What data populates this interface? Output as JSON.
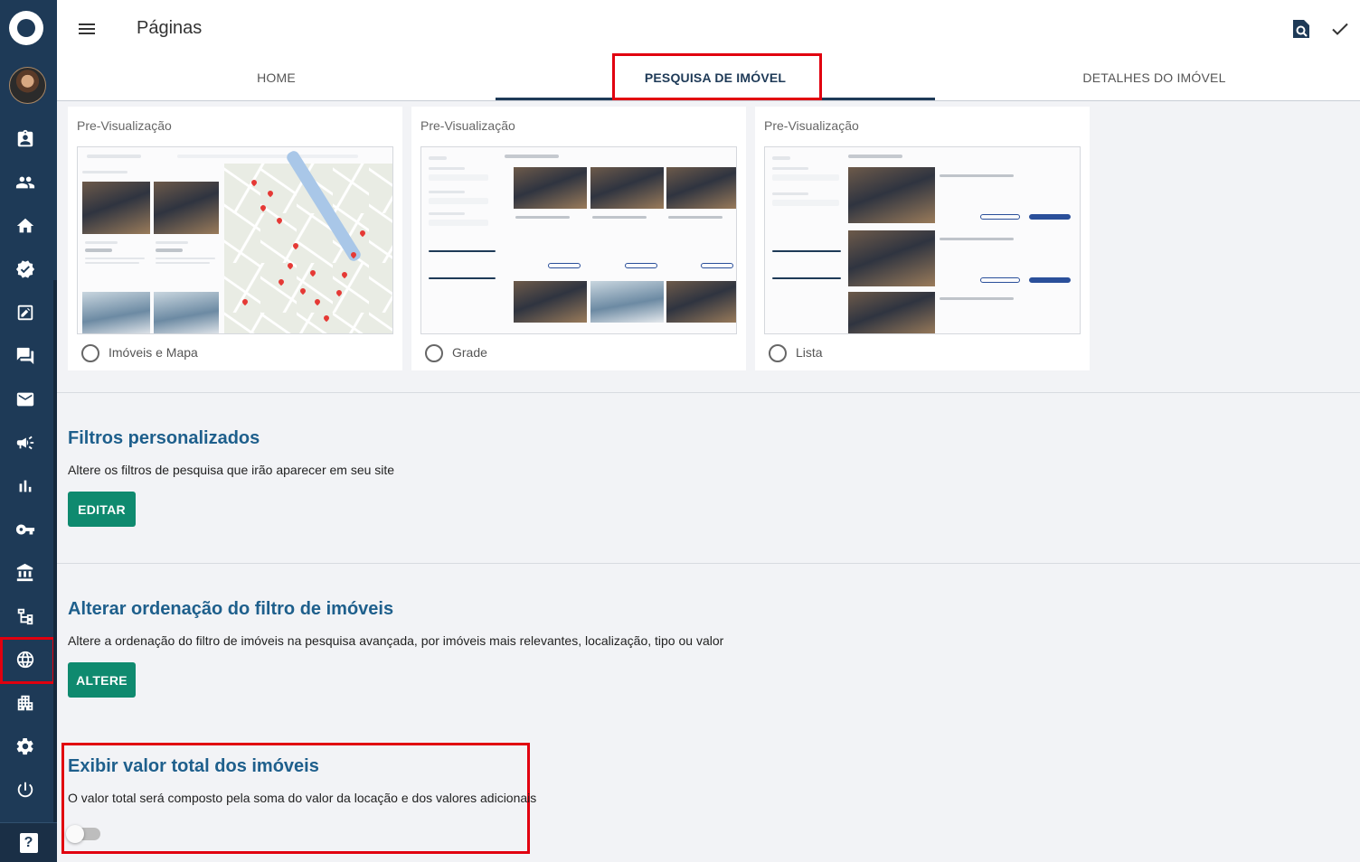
{
  "header": {
    "title": "Páginas",
    "tabs": [
      {
        "label": "HOME",
        "active": false
      },
      {
        "label": "PESQUISA DE IMÓVEL",
        "active": true
      },
      {
        "label": "DETALHES DO IMÓVEL",
        "active": false
      }
    ]
  },
  "sidebar": {
    "icons": [
      "logo-icon",
      "avatar",
      "contacts-icon",
      "people-icon",
      "home-icon",
      "verified-icon",
      "edit-document-icon",
      "chat-icon",
      "mail-icon",
      "megaphone-icon",
      "bar-chart-icon",
      "key-icon",
      "bank-icon",
      "hierarchy-icon",
      "globe-icon",
      "buildings-icon",
      "settings-icon",
      "power-icon",
      "help-icon"
    ],
    "active_item": "globe-icon",
    "help_glyph": "?"
  },
  "previews": [
    {
      "title": "Pre-Visualização",
      "option": "Imóveis e Mapa",
      "selected": false
    },
    {
      "title": "Pre-Visualização",
      "option": "Grade",
      "selected": false
    },
    {
      "title": "Pre-Visualização",
      "option": "Lista",
      "selected": false
    }
  ],
  "sections": {
    "filters": {
      "title": "Filtros personalizados",
      "description": "Altere os filtros de pesquisa que irão aparecer em seu site",
      "button": "EDITAR"
    },
    "ordering": {
      "title": "Alterar ordenação do filtro de imóveis",
      "description": "Altere a ordenação do filtro de imóveis na pesquisa avançada, por imóveis mais relevantes, localização, tipo ou valor",
      "button": "ALTERE"
    },
    "total_value": {
      "title": "Exibir valor total dos imóveis",
      "description": "O valor total será composto pela soma do valor da locação e dos valores adicionais",
      "toggle_on": false
    }
  },
  "colors": {
    "sidebar": "#1e3a57",
    "primary_button": "#0f8a6f",
    "section_title": "#1e5f8c",
    "highlight": "#e1000f"
  }
}
